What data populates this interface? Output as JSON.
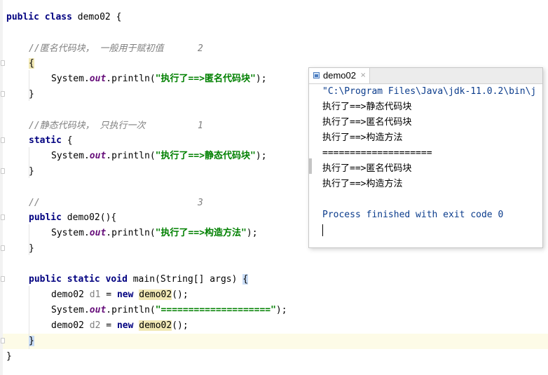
{
  "code": {
    "class_decl": {
      "kw1": "public",
      "kw2": "class",
      "name": "demo02",
      "brace": "{"
    },
    "anon_block": {
      "comment": "//匿名代码块， 一般用于赋初值",
      "order": "2",
      "open": "{",
      "stmt": {
        "pre": "System.",
        "field": "out",
        "mid": ".println(",
        "str": "\"执行了==>匿名代码块\"",
        "post": ");"
      },
      "close": "}"
    },
    "static_block": {
      "comment": "//静态代码块， 只执行一次",
      "order": "1",
      "kw": "static",
      "open": "{",
      "stmt": {
        "pre": "System.",
        "field": "out",
        "mid": ".println(",
        "str": "\"执行了==>静态代码块\"",
        "post": ");"
      },
      "close": "}"
    },
    "constructor": {
      "comment": "//",
      "order": "3",
      "kw": "public",
      "sig": "demo02(){",
      "stmt": {
        "pre": "System.",
        "field": "out",
        "mid": ".println(",
        "str": "\"执行了==>构造方法\"",
        "post": ");"
      },
      "close": "}"
    },
    "main_method": {
      "kw1": "public",
      "kw2": "static",
      "kw3": "void",
      "sig": "main(String[] args)",
      "open": "{",
      "line1": {
        "type": "demo02",
        "var": "d1",
        "eq": "=",
        "kw": "new",
        "ctor": "demo02",
        "post": "();"
      },
      "line2": {
        "pre": "System.",
        "field": "out",
        "mid": ".println(",
        "str": "\"====================\"",
        "post": ");"
      },
      "line3": {
        "type": "demo02",
        "var": "d2",
        "eq": "=",
        "kw": "new",
        "ctor": "demo02",
        "post": "();"
      },
      "close": "}"
    },
    "class_close": "}"
  },
  "run_window": {
    "tab_label": "demo02",
    "tab_close": "×",
    "lines": [
      "\"C:\\Program Files\\Java\\jdk-11.0.2\\bin\\j",
      "执行了==>静态代码块",
      "执行了==>匿名代码块",
      "执行了==>构造方法",
      "====================",
      "执行了==>匿名代码块",
      "执行了==>构造方法",
      "",
      "Process finished with exit code 0"
    ]
  },
  "colors": {
    "keyword": "#000080",
    "comment": "#808080",
    "string": "#008000",
    "static_field": "#660e7a",
    "caret_line": "#fdfbe7",
    "console_system": "#0b3c8c"
  }
}
